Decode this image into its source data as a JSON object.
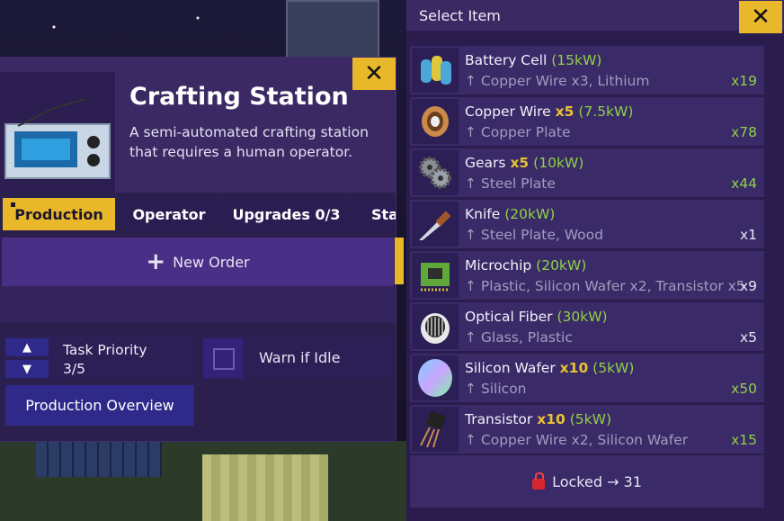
{
  "crafting": {
    "title": "Crafting Station",
    "description": "A semi-automated crafting station that requires a human operator.",
    "close_label": "✕",
    "tabs": [
      {
        "label": "Production",
        "active": true
      },
      {
        "label": "Operator",
        "active": false
      },
      {
        "label": "Upgrades 0/3",
        "active": false
      },
      {
        "label": "Sta",
        "active": false
      }
    ],
    "new_order_label": "New Order",
    "task_priority_label": "Task Priority",
    "task_priority_value": "3/5",
    "warn_idle_label": "Warn if Idle",
    "warn_idle_checked": false,
    "production_overview_label": "Production Overview"
  },
  "select_item": {
    "title": "Select Item",
    "close_label": "✕",
    "items": [
      {
        "name": "Battery Cell",
        "mult": "",
        "power": "(15kW)",
        "ingredients": "↑ Copper Wire x3, Lithium",
        "count": "x19",
        "count_color": "green",
        "icon": "battery-cell-icon"
      },
      {
        "name": "Copper Wire",
        "mult": "x5",
        "power": "(7.5kW)",
        "ingredients": "↑ Copper Plate",
        "count": "x78",
        "count_color": "green",
        "icon": "copper-wire-icon"
      },
      {
        "name": "Gears",
        "mult": "x5",
        "power": "(10kW)",
        "ingredients": "↑ Steel Plate",
        "count": "x44",
        "count_color": "green",
        "icon": "gears-icon"
      },
      {
        "name": "Knife",
        "mult": "",
        "power": "(20kW)",
        "ingredients": "↑ Steel Plate, Wood",
        "count": "x1",
        "count_color": "white",
        "icon": "knife-icon"
      },
      {
        "name": "Microchip",
        "mult": "",
        "power": "(20kW)",
        "ingredients": "↑ Plastic, Silicon Wafer x2, Transistor x5",
        "count": "x9",
        "count_color": "white",
        "icon": "microchip-icon"
      },
      {
        "name": "Optical Fiber",
        "mult": "",
        "power": "(30kW)",
        "ingredients": "↑ Glass, Plastic",
        "count": "x5",
        "count_color": "white",
        "icon": "optical-fiber-icon"
      },
      {
        "name": "Silicon Wafer",
        "mult": "x10",
        "power": "(5kW)",
        "ingredients": "↑ Silicon",
        "count": "x50",
        "count_color": "green",
        "icon": "silicon-wafer-icon"
      },
      {
        "name": "Transistor",
        "mult": "x10",
        "power": "(5kW)",
        "ingredients": "↑ Copper Wire x2, Silicon Wafer",
        "count": "x15",
        "count_color": "green",
        "icon": "transistor-icon"
      }
    ],
    "locked_label": "Locked → 31"
  },
  "colors": {
    "accent": "#e9b72a",
    "green": "#8ed146",
    "panel": "#2a1d4e",
    "button": "#2f2a8a"
  }
}
